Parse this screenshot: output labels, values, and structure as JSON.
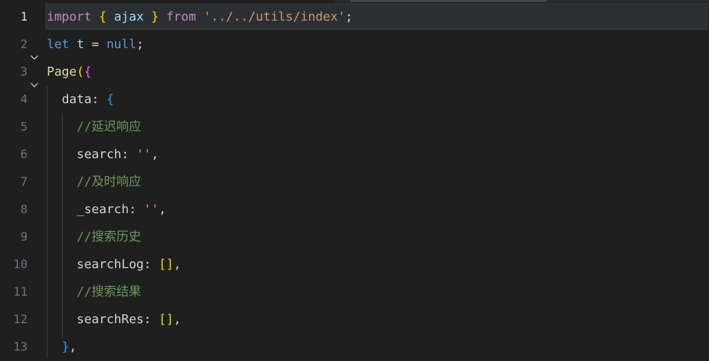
{
  "editor": {
    "lines": [
      {
        "num": "1",
        "tokens": [
          [
            "imp",
            "import"
          ],
          [
            "pun",
            " "
          ],
          [
            "brace3",
            "{"
          ],
          [
            "pun",
            " "
          ],
          [
            "id",
            "ajax"
          ],
          [
            "pun",
            " "
          ],
          [
            "brace3",
            "}"
          ],
          [
            "pun",
            " "
          ],
          [
            "imp",
            "from"
          ],
          [
            "pun",
            " "
          ],
          [
            "str",
            "'../../utils/index'"
          ],
          [
            "pun",
            ";"
          ]
        ]
      },
      {
        "num": "2",
        "tokens": [
          [
            "kw",
            "let"
          ],
          [
            "pun",
            " "
          ],
          [
            "id",
            "t"
          ],
          [
            "pun",
            " = "
          ],
          [
            "nullc",
            "null"
          ],
          [
            "pun",
            ";"
          ]
        ]
      },
      {
        "num": "3",
        "tokens": [
          [
            "fn",
            "Page"
          ],
          [
            "brace3",
            "("
          ],
          [
            "brace",
            "{"
          ]
        ]
      },
      {
        "num": "4",
        "tokens": [
          [
            "pun",
            "  "
          ],
          [
            "prop",
            "data"
          ],
          [
            "pun",
            ": "
          ],
          [
            "brace2",
            "{"
          ]
        ]
      },
      {
        "num": "5",
        "tokens": [
          [
            "pun",
            "    "
          ],
          [
            "cmt",
            "//延迟响应"
          ]
        ]
      },
      {
        "num": "6",
        "tokens": [
          [
            "pun",
            "    "
          ],
          [
            "prop",
            "search"
          ],
          [
            "pun",
            ": "
          ],
          [
            "str",
            "''"
          ],
          [
            "pun",
            ","
          ]
        ]
      },
      {
        "num": "7",
        "tokens": [
          [
            "pun",
            "    "
          ],
          [
            "cmt",
            "//及时响应"
          ]
        ]
      },
      {
        "num": "8",
        "tokens": [
          [
            "pun",
            "    "
          ],
          [
            "prop",
            "_search"
          ],
          [
            "pun",
            ": "
          ],
          [
            "str",
            "''"
          ],
          [
            "pun",
            ","
          ]
        ]
      },
      {
        "num": "9",
        "tokens": [
          [
            "pun",
            "    "
          ],
          [
            "cmt",
            "//搜索历史"
          ]
        ]
      },
      {
        "num": "10",
        "tokens": [
          [
            "pun",
            "    "
          ],
          [
            "prop",
            "searchLog"
          ],
          [
            "pun",
            ": "
          ],
          [
            "brace3",
            "[]"
          ],
          [
            "pun",
            ","
          ]
        ]
      },
      {
        "num": "11",
        "tokens": [
          [
            "pun",
            "    "
          ],
          [
            "cmt",
            "//搜索结果"
          ]
        ]
      },
      {
        "num": "12",
        "tokens": [
          [
            "pun",
            "    "
          ],
          [
            "prop",
            "searchRes"
          ],
          [
            "pun",
            ": "
          ],
          [
            "brace3",
            "[]"
          ],
          [
            "pun",
            ","
          ]
        ]
      },
      {
        "num": "13",
        "tokens": [
          [
            "pun",
            "  "
          ],
          [
            "brace2",
            "}"
          ],
          [
            "pun",
            ","
          ]
        ]
      }
    ],
    "active_line": "1",
    "folded_lines": [
      "3",
      "4"
    ],
    "fold_icon": "chevron-down-icon"
  }
}
